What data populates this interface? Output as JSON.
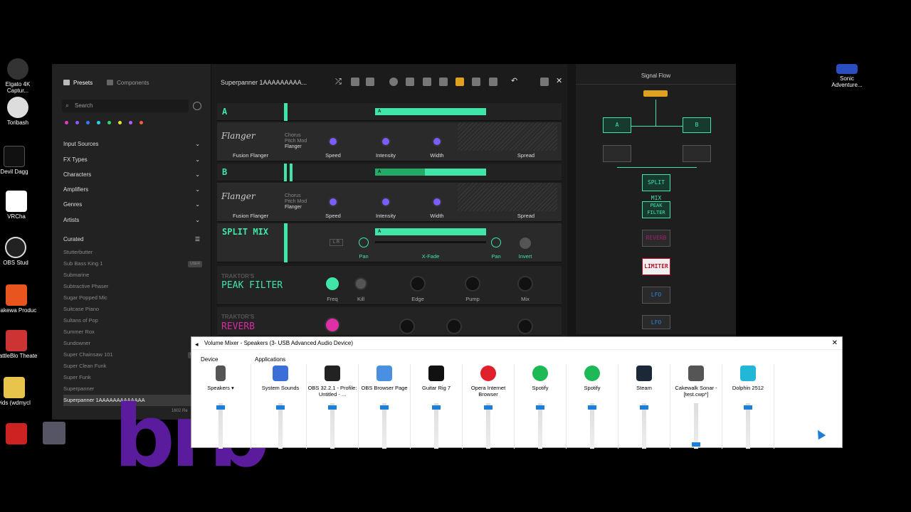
{
  "desktop": {
    "left_icons": [
      "Elgato 4K Captur...",
      "Toribash",
      "Devil Dagg",
      "VRCha",
      "OBS Stud",
      "Cakewa Produc",
      "BattleBlo Theate",
      "vids (wdmycl"
    ],
    "right_icons": [
      "Sonic Adventure..."
    ]
  },
  "browser": {
    "tabs": [
      "Presets",
      "Components"
    ],
    "search_placeholder": "Search",
    "categories": [
      "Input Sources",
      "FX Types",
      "Characters",
      "Amplifiers",
      "Genres",
      "Artists"
    ],
    "curated_label": "Curated",
    "presets": [
      {
        "name": "Stutterbutter",
        "badge": ""
      },
      {
        "name": "Sub Bass King 1",
        "badge": "USER"
      },
      {
        "name": "Submarine",
        "badge": ""
      },
      {
        "name": "Subtractive Phaser",
        "badge": ""
      },
      {
        "name": "Sugar Popped Mic",
        "badge": ""
      },
      {
        "name": "Suitcase Piano",
        "badge": ""
      },
      {
        "name": "Sultans of Pop",
        "badge": ""
      },
      {
        "name": "Summer Rox",
        "badge": ""
      },
      {
        "name": "Sundowner",
        "badge": ""
      },
      {
        "name": "Super Chainsaw 101",
        "badge": "USER"
      },
      {
        "name": "Super Clean Funk",
        "badge": ""
      },
      {
        "name": "Super Funk",
        "badge": ""
      },
      {
        "name": "Superpanner",
        "badge": ""
      },
      {
        "name": "Superpanner 1AAAAAAAAAAAAA",
        "badge": "USE"
      }
    ],
    "count": "1602 Re"
  },
  "rack": {
    "preset_name": "Superpanner 1AAAAAAAAA...",
    "row_a": "A",
    "row_b": "B",
    "split_mix": "SPLIT MIX",
    "flanger": {
      "modes": [
        "Chorus",
        "Pitch Mod",
        "Flanger"
      ],
      "preset": "Fusion Flanger",
      "knobs": [
        "Speed",
        "Intensity",
        "Width",
        "Spread"
      ]
    },
    "split": {
      "lr": "L R",
      "pan_left": "Pan",
      "xfade": "X-Fade",
      "pan_right": "Pan",
      "invert": "Invert"
    },
    "peak": {
      "brand": "TRAKTOR'S",
      "name": "PEAK FILTER",
      "knobs": [
        "Freq",
        "Kill",
        "Edge",
        "Pump",
        "Mix"
      ]
    },
    "reverb": {
      "brand": "TRAKTOR'S",
      "name": "REVERB"
    }
  },
  "signal_flow": {
    "title": "Signal Flow",
    "a": "A",
    "b": "B",
    "split_mix": "SPLIT MIX",
    "peak": "PEAK FILTER",
    "reverb": "REVERB",
    "limiter": "LIMITER",
    "lfo1": "LFO",
    "lfo2": "LFO"
  },
  "volume_mixer": {
    "title": "Volume Mixer - Speakers (3- USB Advanced Audio Device)",
    "device_label": "Device",
    "applications_label": "Applications",
    "device": {
      "name": "Speakers",
      "level": 0.95
    },
    "apps": [
      {
        "name": "System Sounds",
        "level": 0.95,
        "color": "#3a6fd8"
      },
      {
        "name": "OBS 32.2.1 - Profile: Untitled - ...",
        "level": 0.95,
        "color": "#222222"
      },
      {
        "name": "OBS Browser Page",
        "level": 0.95,
        "color": "#4a90e2"
      },
      {
        "name": "Guitar Rig 7",
        "level": 0.95,
        "color": "#111111"
      },
      {
        "name": "Opera Internet Browser",
        "level": 0.95,
        "color": "#e0202b"
      },
      {
        "name": "Spotify",
        "level": 0.95,
        "color": "#1db954"
      },
      {
        "name": "Spotify",
        "level": 0.95,
        "color": "#1db954"
      },
      {
        "name": "Steam",
        "level": 0.95,
        "color": "#1b2838"
      },
      {
        "name": "Cakewalk Sonar - [test.cwp*]",
        "level": 0.05,
        "color": "#555555"
      },
      {
        "name": "Dolphin 2512",
        "level": 0.95,
        "color": "#22b7d6"
      }
    ]
  },
  "overlay_text": "brb"
}
